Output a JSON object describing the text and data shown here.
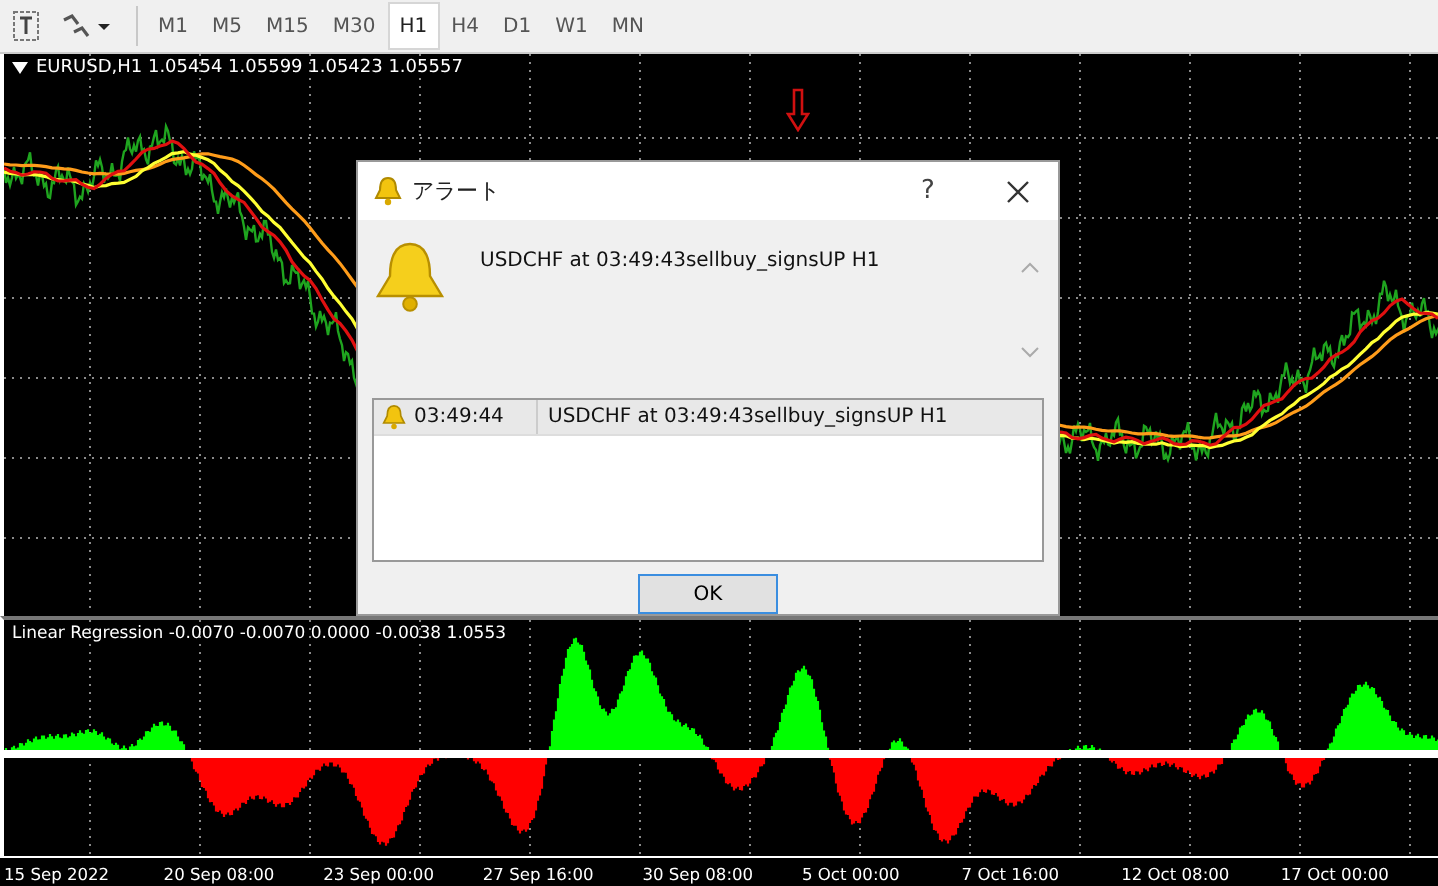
{
  "toolbar": {
    "timeframes": [
      {
        "label": "M1",
        "selected": false
      },
      {
        "label": "M5",
        "selected": false
      },
      {
        "label": "M15",
        "selected": false
      },
      {
        "label": "M30",
        "selected": false
      },
      {
        "label": "H1",
        "selected": true
      },
      {
        "label": "H4",
        "selected": false
      },
      {
        "label": "D1",
        "selected": false
      },
      {
        "label": "W1",
        "selected": false
      },
      {
        "label": "MN",
        "selected": false
      }
    ]
  },
  "chart": {
    "title": "EURUSD,H1  1.05454 1.05599 1.05423 1.05557"
  },
  "indicator": {
    "label": "Linear Regression  -0.0070 -0.0070 0.0000 -0.0038 1.0553"
  },
  "time_axis": [
    "15 Sep 2022",
    "20 Sep 08:00",
    "23 Sep 00:00",
    "27 Sep 16:00",
    "30 Sep 08:00",
    "5 Oct 00:00",
    "7 Oct 16:00",
    "12 Oct 08:00",
    "17 Oct 00:00"
  ],
  "dialog": {
    "title": "アラート",
    "help": "?",
    "message": "USDCHF at 03:49:43sellbuy_signsUP H1",
    "list": [
      {
        "time": "03:49:44",
        "message": "USDCHF at 03:49:43sellbuy_signsUP H1",
        "selected": true
      }
    ],
    "ok": "OK"
  }
}
